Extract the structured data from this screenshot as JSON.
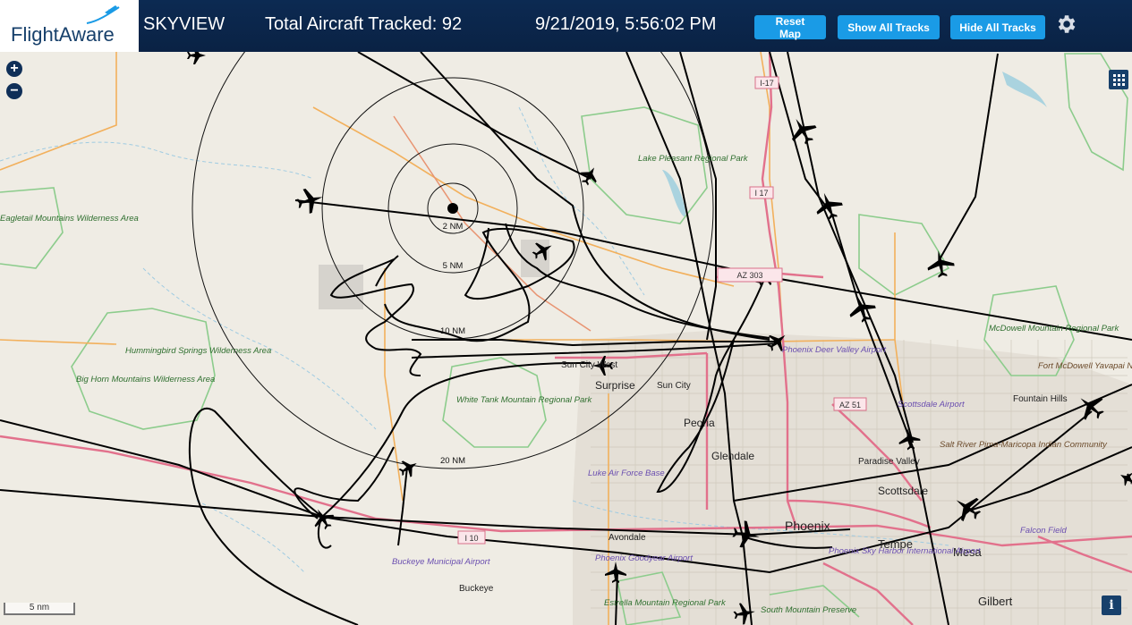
{
  "header": {
    "logo": "FlightAware",
    "title": "SKYVIEW",
    "aircraft_tracked": "Total Aircraft Tracked: 92",
    "datetime": "9/21/2019, 5:56:02 PM",
    "reset_label": "Reset Map",
    "show_tracks_label": "Show All Tracks",
    "hide_tracks_label": "Hide All Tracks"
  },
  "controls": {
    "zoom_in": "+",
    "zoom_out": "−",
    "info": "i",
    "scale": "5 nm"
  },
  "range_rings": [
    "2 NM",
    "5 NM",
    "10 NM",
    "20 NM"
  ],
  "places": [
    "Phoenix",
    "Glendale",
    "Peoria",
    "Surprise",
    "Sun City",
    "Sun City West",
    "Scottsdale",
    "Paradise Valley",
    "Tempe",
    "Mesa",
    "Gilbert",
    "Avondale",
    "Buckeye",
    "Fountain Hills"
  ],
  "parks": [
    "Lake Pleasant Regional Park",
    "White Tank Mountain Regional Park",
    "Hummingbird Springs Wilderness Area",
    "Big Horn Mountains Wilderness Area",
    "McDowell Mountain Regional Park",
    "Eagletail Mountains Wilderness Area",
    "Estrella Mountain Regional Park",
    "South Mountain Preserve",
    "Salt River Pima-Maricopa Indian Community",
    "Fort McDowell Yavapai Nation"
  ],
  "airports": [
    "Phoenix Deer Valley Airport",
    "Luke Air Force Base",
    "Phoenix Sky Harbor International Airport",
    "Scottsdale Airport",
    "Buckeye Municipal Airport",
    "Phoenix Goodyear Airport",
    "Falcon Field"
  ],
  "highways": [
    "I-17",
    "I 17",
    "AZ 303",
    "AZ 51",
    "I 10"
  ],
  "colors": {
    "header_bg": "#0a2244",
    "button": "#1a9be6",
    "map_bg": "#efece4",
    "road_major": "#e2718c",
    "road_minor": "#f2b05c",
    "park_border": "#7fbf7f",
    "track": "#000000"
  }
}
